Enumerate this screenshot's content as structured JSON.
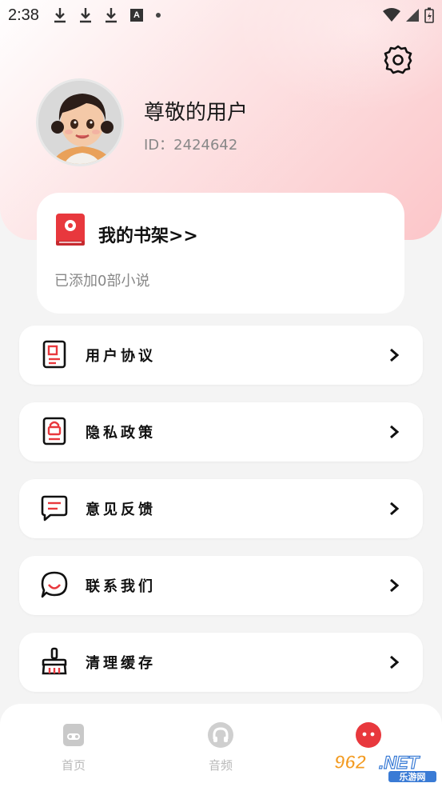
{
  "status_bar": {
    "time": "2:38",
    "a_badge": "A"
  },
  "profile": {
    "username": "尊敬的用户",
    "id_text": "ID：2424642"
  },
  "bookshelf": {
    "title": "我的书架>>",
    "subtitle": "已添加0部小说"
  },
  "menu": [
    {
      "label": "用户协议",
      "icon": "document-icon"
    },
    {
      "label": "隐私政策",
      "icon": "lock-document-icon"
    },
    {
      "label": "意见反馈",
      "icon": "feedback-message-icon"
    },
    {
      "label": "联系我们",
      "icon": "chat-bubble-icon"
    },
    {
      "label": "清理缓存",
      "icon": "broom-icon"
    }
  ],
  "bottom_nav": [
    {
      "label": "首页",
      "icon": "home-book-icon"
    },
    {
      "label": "音频",
      "icon": "headphones-icon"
    },
    {
      "label": "",
      "icon": "profile-face-icon",
      "active": true
    }
  ],
  "watermark": {
    "brand": "962.NET",
    "sub": "乐游网"
  },
  "colors": {
    "accent": "#e8383d",
    "header_gradient_end": "#fcc6c9",
    "background": "#f4f4f4",
    "secondary_text": "#888888"
  }
}
